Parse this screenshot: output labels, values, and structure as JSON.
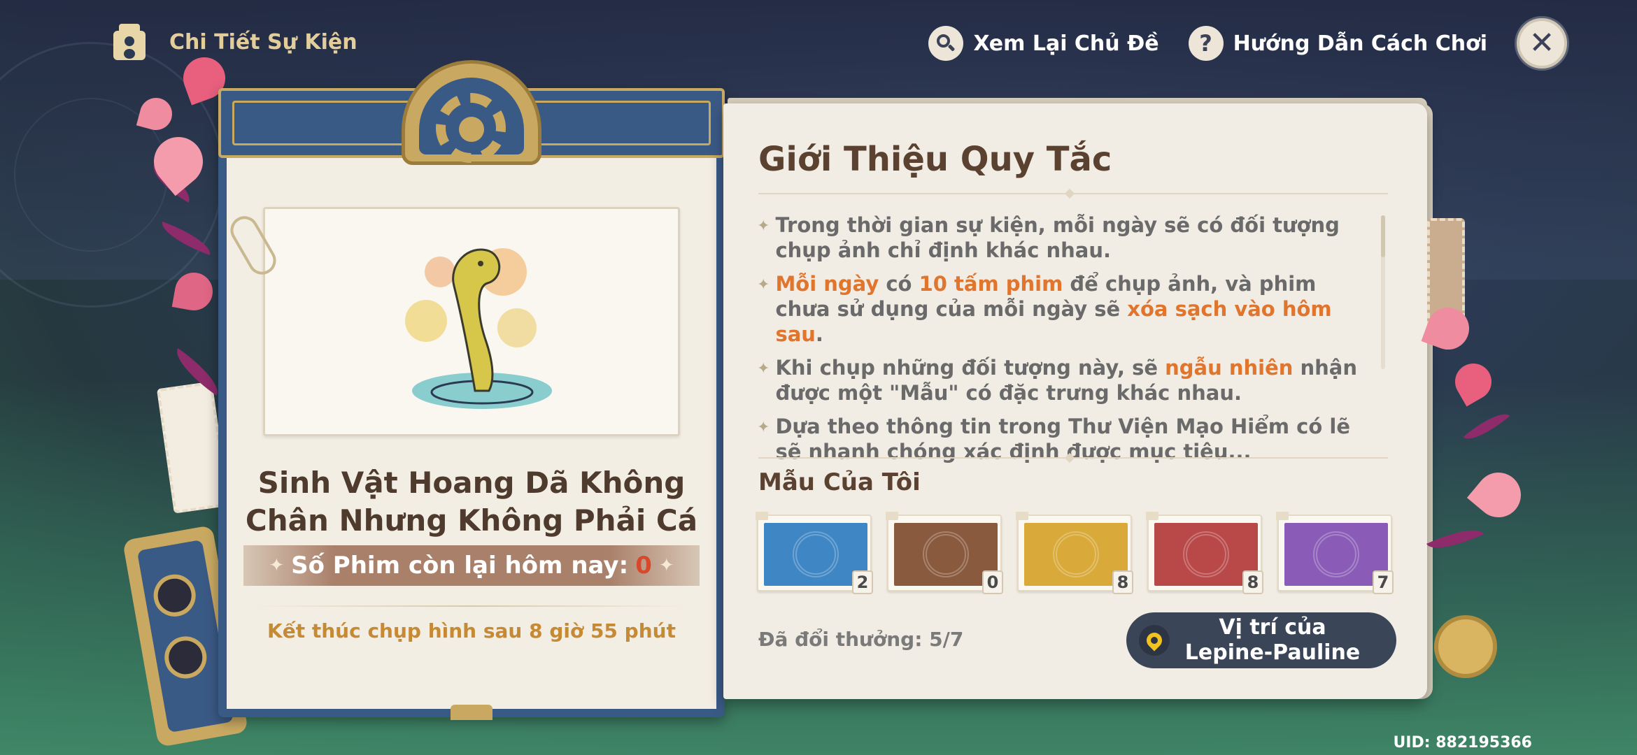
{
  "header": {
    "title": "Chi Tiết Sự Kiện",
    "review_theme_label": "Xem Lại Chủ Đề",
    "guide_label": "Hướng Dẫn Cách Chơi"
  },
  "card": {
    "creature_title_line1": "Sinh Vật Hoang Dã Không",
    "creature_title_line2": "Chân Nhưng Không Phải Cá",
    "film_label": "Số Phim còn lại hôm nay:",
    "film_count": "0",
    "end_text": "Kết thúc chụp hình sau 8 giờ 55 phút"
  },
  "rules": {
    "title": "Giới Thiệu Quy Tắc",
    "items": [
      {
        "p1": "Trong thời gian sự kiện, mỗi ngày sẽ có đối tượng chụp ảnh chỉ định khác nhau."
      },
      {
        "h1": "Mỗi ngày",
        "p1": " có ",
        "h2": "10 tấm phim",
        "p2": " để chụp ảnh, và phim chưa sử dụng của mỗi ngày sẽ ",
        "h3": "xóa sạch vào hôm sau",
        "p3": "."
      },
      {
        "p1": "Khi chụp những đối tượng này, sẽ ",
        "h1": "ngẫu nhiên",
        "p2": " nhận được một \"Mẫu\" có đặc trưng khác nhau."
      },
      {
        "p1": "Dựa theo thông tin trong Thư Viện Mạo Hiểm có lẽ sẽ nhanh chóng xác định được mục tiêu..."
      }
    ]
  },
  "samples": {
    "title": "Mẫu Của Tôi",
    "items": [
      {
        "color": "#3f86c4",
        "count": "2"
      },
      {
        "color": "#8a5a3e",
        "count": "0"
      },
      {
        "color": "#d9aa3a",
        "count": "8"
      },
      {
        "color": "#b94848",
        "count": "8"
      },
      {
        "color": "#8a5cb8",
        "count": "7"
      }
    ]
  },
  "footer": {
    "exchange_text": "Đã đổi thưởng: 5/7",
    "location_line1": "Vị trí của",
    "location_line2": "Lepine-Pauline",
    "uid": "UID: 882195366"
  },
  "colors": {
    "accent_orange": "#e0752e",
    "card_blue": "#3a5a86",
    "gold": "#c9a962"
  }
}
